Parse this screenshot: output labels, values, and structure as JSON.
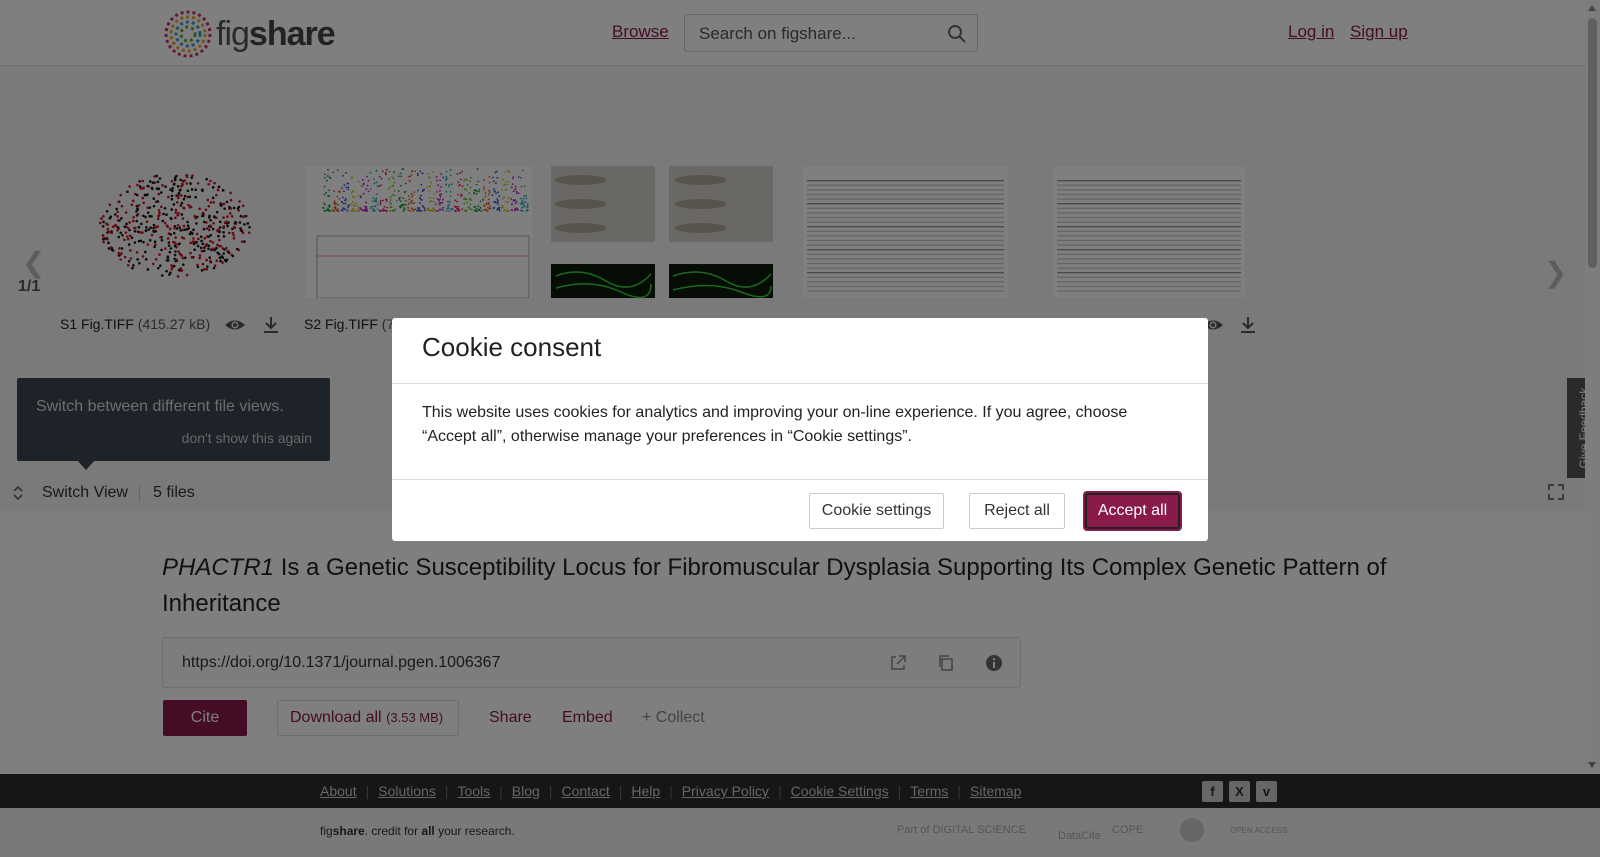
{
  "header": {
    "logo_text_1": "fig",
    "logo_text_2": "share",
    "browse": "Browse",
    "search_placeholder": "Search on figshare...",
    "login": "Log in",
    "signup": "Sign up"
  },
  "carousel": {
    "pager": "1/1",
    "files": [
      {
        "name": "S1 Fig.TIFF",
        "size": "(415.27 kB)"
      },
      {
        "name": "S2 Fig.TIFF",
        "size": "(7"
      }
    ],
    "tooltip_msg": "Switch between different file views.",
    "tooltip_dont": "don't show this again",
    "switch_view": "Switch View",
    "files_count": "5 files"
  },
  "article": {
    "title_italic": "PHACTR1",
    "title_rest": " Is a Genetic Susceptibility Locus for Fibromuscular Dysplasia Supporting Its Complex Genetic Pattern of Inheritance",
    "doi": "https://doi.org/10.1371/journal.pgen.1006367",
    "cite": "Cite",
    "download_all": "Download all",
    "download_size": "(3.53 MB)",
    "share": "Share",
    "embed": "Embed",
    "collect": "+ Collect"
  },
  "footer": {
    "links": [
      "About",
      "Solutions",
      "Tools",
      "Blog",
      "Contact",
      "Help",
      "Privacy Policy",
      "Cookie Settings",
      "Terms",
      "Sitemap"
    ],
    "tagline_pre": "fig",
    "tagline_bold": "share",
    "tagline_mid": ". credit for ",
    "tagline_all": "all",
    "tagline_post": " your research.",
    "partners": [
      "Part of DIGITAL SCIENCE",
      "DataCite",
      "COPE",
      "",
      "OPEN ACCESS"
    ]
  },
  "cookie": {
    "title": "Cookie consent",
    "body": "This website uses cookies for analytics and improving your on-line experience. If you agree, choose “Accept all”, otherwise manage your preferences in “Cookie settings”.",
    "settings": "Cookie settings",
    "reject": "Reject all",
    "accept": "Accept all"
  },
  "feedback": "Give Feedback",
  "colors": {
    "brand": "#8a1a4a",
    "footer_dark": "#2d2d2d"
  }
}
